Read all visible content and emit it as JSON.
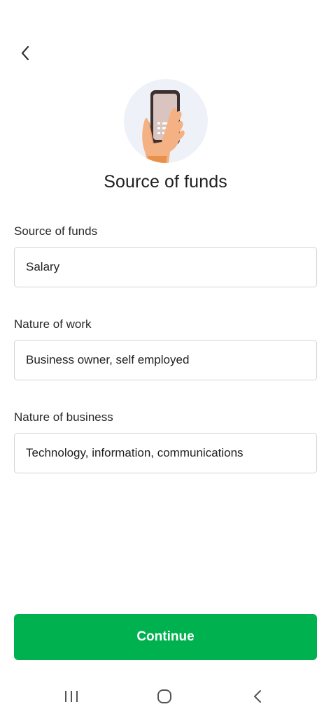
{
  "header": {
    "back_icon": "chevron-left-icon",
    "illustration": "hand-holding-phone-illustration"
  },
  "page": {
    "title": "Source of funds"
  },
  "form": {
    "fields": [
      {
        "label": "Source of funds",
        "value": "Salary"
      },
      {
        "label": "Nature of work",
        "value": "Business owner, self employed"
      },
      {
        "label": "Nature of business",
        "value": "Technology, information, communications"
      }
    ]
  },
  "footer": {
    "continue_label": "Continue"
  },
  "system_nav": {
    "items": [
      "recent-apps-icon",
      "home-icon",
      "back-icon"
    ]
  },
  "colors": {
    "accent": "#00b14f",
    "field_border": "#cfd3d8",
    "illustration_bg": "#eef2f8"
  }
}
